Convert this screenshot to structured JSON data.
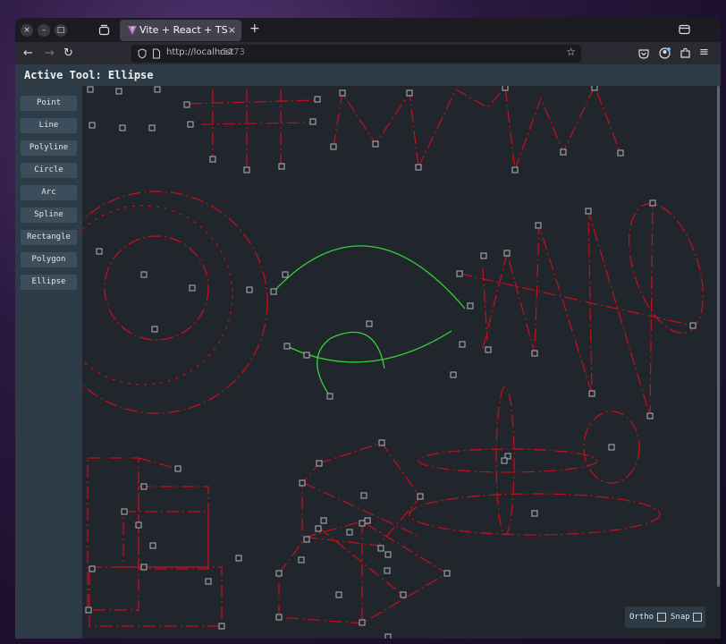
{
  "browser": {
    "tab_title": "Vite + React + TS",
    "tab_close": "×",
    "new_tab": "+",
    "url_host": "http://localhost",
    "url_port": ":5173",
    "window_buttons": {
      "close": "×",
      "minimize": "–",
      "maximize": "□"
    }
  },
  "app": {
    "active_tool_label": "Active Tool: Ellipse",
    "tools": [
      "Point",
      "Line",
      "Polyline",
      "Circle",
      "Arc",
      "Spline",
      "Rectangle",
      "Polygon",
      "Ellipse"
    ],
    "ortho_label": "Ortho",
    "snap_label": "Snap",
    "ortho_checked": false,
    "snap_checked": false
  },
  "colors": {
    "shape_red": "#c0101c",
    "arc_green": "#35d23a",
    "handle": "#b0b6bb",
    "canvas_bg": "#20262b",
    "panel_bg": "#2d3b46",
    "button_bg": "#3c4e5b"
  }
}
